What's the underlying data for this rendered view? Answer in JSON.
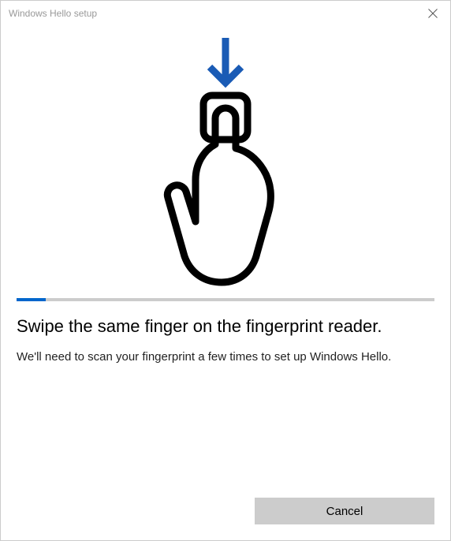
{
  "titlebar": {
    "title": "Windows Hello setup"
  },
  "progress": {
    "percent": 7
  },
  "main": {
    "heading": "Swipe the same finger on the fingerprint reader.",
    "subtext": "We'll need to scan your fingerprint a few times to set up Windows Hello."
  },
  "footer": {
    "cancel_label": "Cancel"
  }
}
